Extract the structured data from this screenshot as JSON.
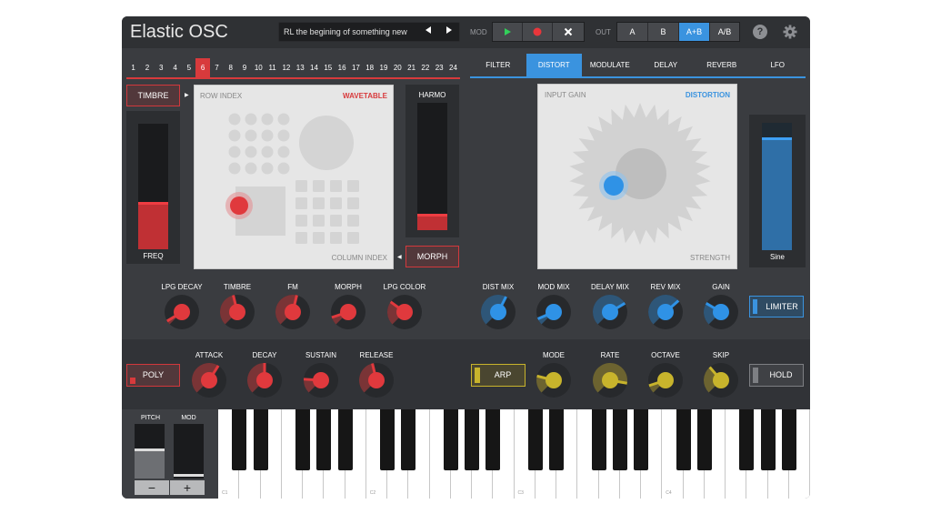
{
  "header": {
    "title": "Elastic OSC",
    "preset": "RL the begining of something new",
    "prev_icon": "triangle-left",
    "next_icon": "triangle-right",
    "mod_label": "MOD",
    "out_label": "OUT",
    "transport": {
      "play_icon": "play",
      "record_icon": "record",
      "clear_icon": "x"
    },
    "out_options": [
      "A",
      "B",
      "A+B",
      "A/B"
    ],
    "out_selected": "A+B",
    "help_label": "?",
    "settings_icon": "gear"
  },
  "sequencer": {
    "steps": [
      "1",
      "2",
      "3",
      "4",
      "5",
      "6",
      "7",
      "8",
      "9",
      "10",
      "11",
      "12",
      "13",
      "14",
      "15",
      "16",
      "17",
      "18",
      "19",
      "20",
      "21",
      "22",
      "23",
      "24"
    ],
    "active_step": "6"
  },
  "tabs": {
    "items": [
      "FILTER",
      "DISTORT",
      "MODULATE",
      "DELAY",
      "REVERB",
      "LFO"
    ],
    "active": "DISTORT"
  },
  "oscillator": {
    "timbre_button": "TIMBRE",
    "freq_label": "FREQ",
    "freq_level": 0.37,
    "pad_row_label": "ROW INDEX",
    "pad_title": "WAVETABLE",
    "pad_col_label": "COLUMN INDEX",
    "harmo_label": "HARMO",
    "harmo_level": 0.12,
    "morph_button": "MORPH"
  },
  "distortion": {
    "pad_input_label": "INPUT GAIN",
    "pad_title": "DISTORTION",
    "pad_strength_label": "STRENGTH",
    "lfo_label": "Sine",
    "lfo_level": 0.88
  },
  "knobs_red": [
    {
      "label": "LPG DECAY",
      "value": 0.05
    },
    {
      "label": "TIMBRE",
      "value": 0.45
    },
    {
      "label": "FM",
      "value": 0.55
    },
    {
      "label": "MORPH",
      "value": 0.1
    },
    {
      "label": "LPG COLOR",
      "value": 0.3
    }
  ],
  "knobs_blue": [
    {
      "label": "DIST MIX",
      "value": 0.6
    },
    {
      "label": "MOD MIX",
      "value": 0.08
    },
    {
      "label": "DELAY MIX",
      "value": 0.72
    },
    {
      "label": "REV MIX",
      "value": 0.68
    },
    {
      "label": "GAIN",
      "value": 0.28
    }
  ],
  "limiter_button": "LIMITER",
  "envelope": {
    "poly_button": "POLY",
    "knobs": [
      {
        "label": "ATTACK",
        "value": 0.62
      },
      {
        "label": "DECAY",
        "value": 0.5
      },
      {
        "label": "SUSTAIN",
        "value": 0.18
      },
      {
        "label": "RELEASE",
        "value": 0.45
      }
    ]
  },
  "arp": {
    "arp_button": "ARP",
    "knobs": [
      {
        "label": "MODE",
        "value": 0.22
      },
      {
        "label": "RATE",
        "value": 0.87
      },
      {
        "label": "OCTAVE",
        "value": 0.1
      },
      {
        "label": "SKIP",
        "value": 0.35
      }
    ],
    "hold_button": "HOLD"
  },
  "performance": {
    "pitch_label": "PITCH",
    "mod_label": "MOD",
    "minus_label": "−",
    "plus_label": "+"
  },
  "keyboard": {
    "octave_labels": [
      "C1",
      "C2",
      "C3",
      "C4"
    ]
  },
  "colors": {
    "accent_red": "#d83a3c",
    "accent_blue": "#3a93df",
    "accent_yellow": "#c8b42c",
    "panel": "#3a3c40"
  }
}
